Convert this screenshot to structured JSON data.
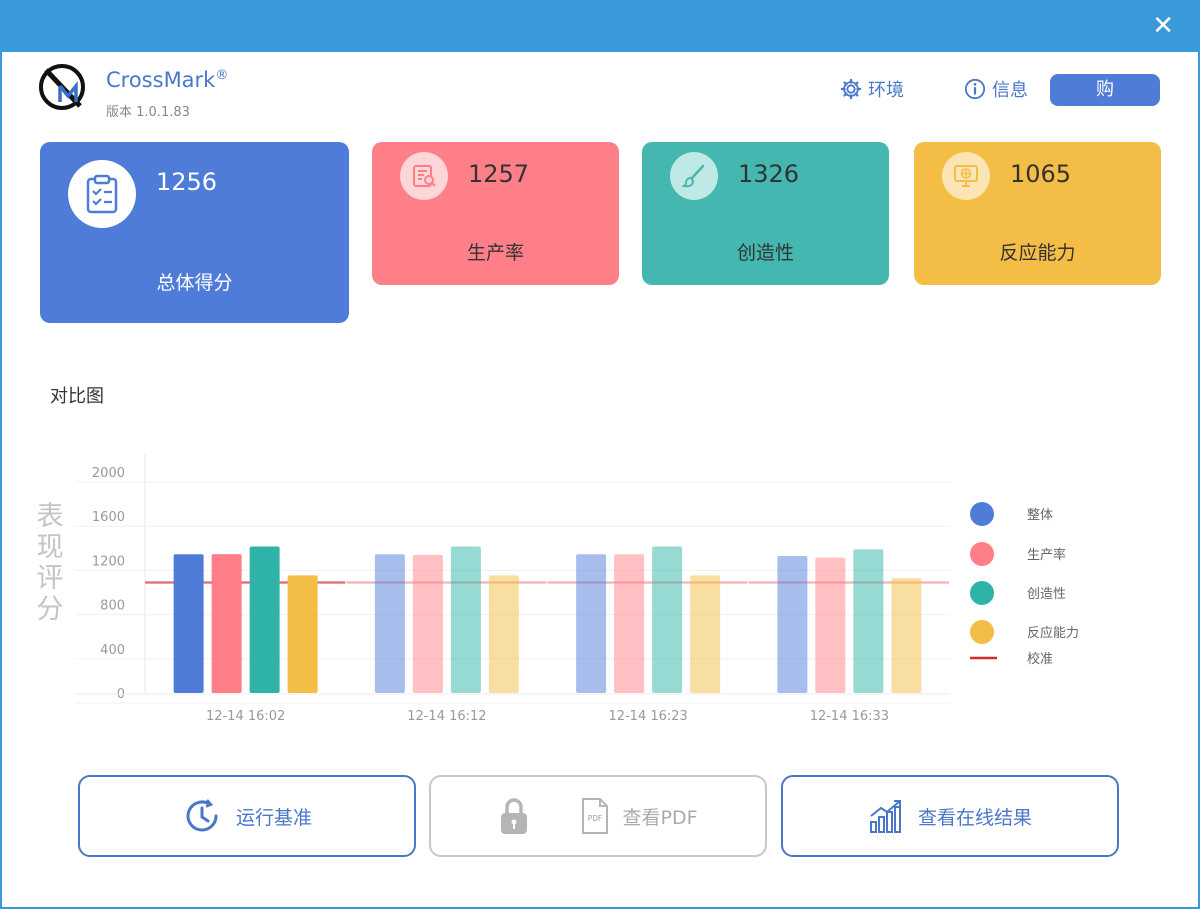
{
  "window": {
    "close_glyph": "✕"
  },
  "app": {
    "name": "CrossMark",
    "registered": "®",
    "version": "版本 1.0.1.83"
  },
  "nav": {
    "environment_label": "环境",
    "info_label": "信息",
    "buy_label": "购"
  },
  "scores": {
    "overall": {
      "value": "1256",
      "label": "总体得分",
      "color": "#4f7cd9"
    },
    "productivity": {
      "value": "1257",
      "label": "生产率",
      "color": "#ff7f88"
    },
    "creativity": {
      "value": "1326",
      "label": "创造性",
      "color": "#44b8b0"
    },
    "responsiveness": {
      "value": "1065",
      "label": "反应能力",
      "color": "#f4bd45"
    }
  },
  "comparison": {
    "title": "对比图"
  },
  "chart_data": {
    "type": "bar",
    "ylabel": "表现评分",
    "ylim": [
      0,
      2000
    ],
    "yticks": [
      "0",
      "400",
      "800",
      "1200",
      "1600",
      "2000"
    ],
    "categories": [
      "12-14 16:02",
      "12-14 16:12",
      "12-14 16:23",
      "12-14 16:33"
    ],
    "series": [
      {
        "name": "整体",
        "color": "#4f7cd9",
        "values": [
          1256,
          1256,
          1256,
          1240
        ]
      },
      {
        "name": "生产率",
        "color": "#ff7f88",
        "values": [
          1257,
          1250,
          1256,
          1225
        ]
      },
      {
        "name": "创造性",
        "color": "#2fb3a8",
        "values": [
          1326,
          1326,
          1326,
          1300
        ]
      },
      {
        "name": "反应能力",
        "color": "#f4bd45",
        "values": [
          1065,
          1065,
          1065,
          1040
        ]
      }
    ],
    "calibration": {
      "name": "校准",
      "value": 1000,
      "color": "#d62a2a"
    },
    "legend": "right",
    "grid": true
  },
  "actions": {
    "run_label": "运行基准",
    "pdf_label": "查看PDF",
    "pdf_icon_text": "PDF",
    "online_label": "查看在线结果"
  }
}
